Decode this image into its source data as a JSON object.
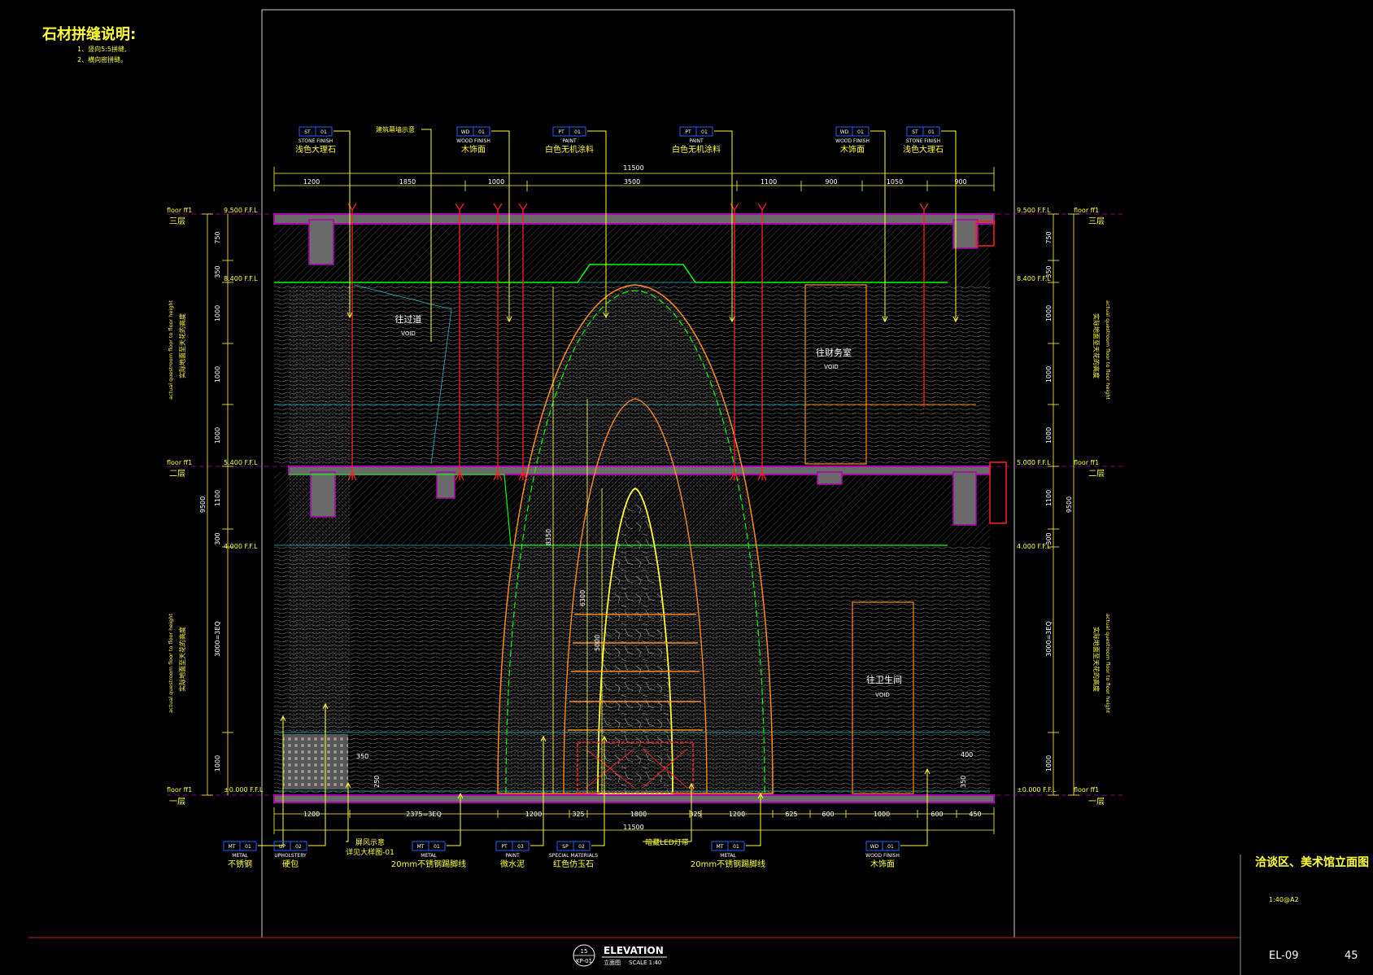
{
  "notes": {
    "title": "石材拼缝说明:",
    "line1": "1、竖向5:5拼缝,",
    "line2": "2、横向密拼缝。"
  },
  "sheet": {
    "drawing_title": "洽谈区、美术馆立面图",
    "scale_note": "1:40@A2",
    "sheet_no": "EL-09",
    "page_no": "45"
  },
  "elevation_tag": {
    "number": "15",
    "ref": "KP-01",
    "label": "ELEVATION",
    "cn_label": "立面图",
    "scale": "SCALE  1:40"
  },
  "dims": {
    "overall": "11500",
    "top": [
      "1200",
      "1850",
      "1000",
      "3500",
      "1100",
      "900",
      "1050",
      "900"
    ],
    "bottom": [
      "1200",
      "2375=3EQ",
      "1200",
      "325",
      "1800",
      "325",
      "1200",
      "625",
      "600",
      "1000",
      "600",
      "450"
    ],
    "left_vert": [
      "750",
      "350",
      "1000",
      "1000",
      "1000",
      "1100",
      "300",
      "3000=3EQ",
      "1000"
    ],
    "left_total": "9500",
    "right_vert": [
      "750",
      "350",
      "1000",
      "1000",
      "1000",
      "1100",
      "300",
      "3000=3EQ",
      "1000"
    ],
    "right_total": "9500",
    "arch_height": "8350",
    "arch_inner": "6300",
    "arch_inner2": "5000",
    "small": [
      "350",
      "250",
      "400",
      "350"
    ]
  },
  "levels": {
    "l3": {
      "ffl": "9.500 F.F.L",
      "floor": "floor  ff1",
      "cn": "三层"
    },
    "l3b": {
      "ffl": "8.400 F.F.L"
    },
    "l2": {
      "ffl": "5.400 F.F.L",
      "floor": "floor  ff1",
      "cn": "二层"
    },
    "l2b": {
      "ffl": "4.000 F.F.L"
    },
    "l1": {
      "ffl": "±0.000 F.F.L",
      "floor": "floor  ff1",
      "cn": "一层"
    },
    "r3": {
      "ffl": "9.500 F.F.L",
      "floor": "floor  ff1",
      "cn": "三层"
    },
    "r3b": {
      "ffl": "8.400 F.F.L"
    },
    "r2": {
      "ffl": "5.000 F.F.L",
      "floor": "floor  ff1",
      "cn": "二层"
    },
    "r2b": {
      "ffl": "4.000 F.F.L"
    },
    "r1": {
      "ffl": "±0.000 F.F.L",
      "floor": "floor  ff1",
      "cn": "一层"
    }
  },
  "side_notes": {
    "left_upper_cn": "实际地面至天花的高度",
    "left_upper_en": "actual questroom floor to floor height",
    "left_lower_cn": "实际地面至天花的高度",
    "left_lower_en": "actual questroom floor to floor height",
    "right_upper_cn": "实际地面至天花的高度",
    "right_upper_en": "actual questroom floor to floor height",
    "right_lower_cn": "实际地面至天花的高度",
    "right_lower_en": "actual questroom floor to floor height"
  },
  "top_callouts": [
    {
      "code": "ST",
      "num": "01",
      "en": "STONE FINISH",
      "cn": "浅色大理石"
    },
    {
      "code": "",
      "num": "",
      "en": "",
      "cn": "建筑幕墙示意"
    },
    {
      "code": "WD",
      "num": "01",
      "en": "WOOD FINISH",
      "cn": "木饰面"
    },
    {
      "code": "PT",
      "num": "01",
      "en": "PAINT",
      "cn": "白色无机涂料"
    },
    {
      "code": "PT",
      "num": "01",
      "en": "PAINT",
      "cn": "白色无机涂料"
    },
    {
      "code": "WD",
      "num": "01",
      "en": "WOOD FINISH",
      "cn": "木饰面"
    },
    {
      "code": "ST",
      "num": "01",
      "en": "STONE FINISH",
      "cn": "浅色大理石"
    }
  ],
  "bottom_callouts": [
    {
      "code": "MT",
      "num": "01",
      "en": "METAL",
      "cn": "不锈钢"
    },
    {
      "code": "UP",
      "num": "02",
      "en": "UPHOLSTERY",
      "cn": "硬包"
    },
    {
      "code": "",
      "num": "",
      "en": "屏风示意",
      "cn": "详见大样图-01"
    },
    {
      "code": "MT",
      "num": "01",
      "en": "METAL",
      "cn": "20mm不锈钢踢脚线"
    },
    {
      "code": "PT",
      "num": "03",
      "en": "PAINT",
      "cn": "微水泥"
    },
    {
      "code": "SP",
      "num": "02",
      "en": "SPECIAL MATERIALS",
      "cn": "红色仿玉石"
    },
    {
      "code": "",
      "num": "",
      "en": "",
      "cn": "暗藏LED灯带"
    },
    {
      "code": "MT",
      "num": "01",
      "en": "METAL",
      "cn": "20mm不锈钢踢脚线"
    },
    {
      "code": "WD",
      "num": "01",
      "en": "WOOD FINISH",
      "cn": "木饰面"
    }
  ],
  "room_labels": {
    "corridor": "往过道",
    "finance": "往财务室",
    "toilet": "往卫生间",
    "void": "VOID"
  },
  "colors": {
    "slab": "#6a6a6a",
    "slab_edge": "#b000b0",
    "yellow": "#ffff33",
    "green": "#00ff00",
    "orange": "#ff8c1a",
    "red": "#ff2020",
    "white": "#ffffff",
    "cyan": "#20c0c0",
    "blue": "#2060ff"
  }
}
